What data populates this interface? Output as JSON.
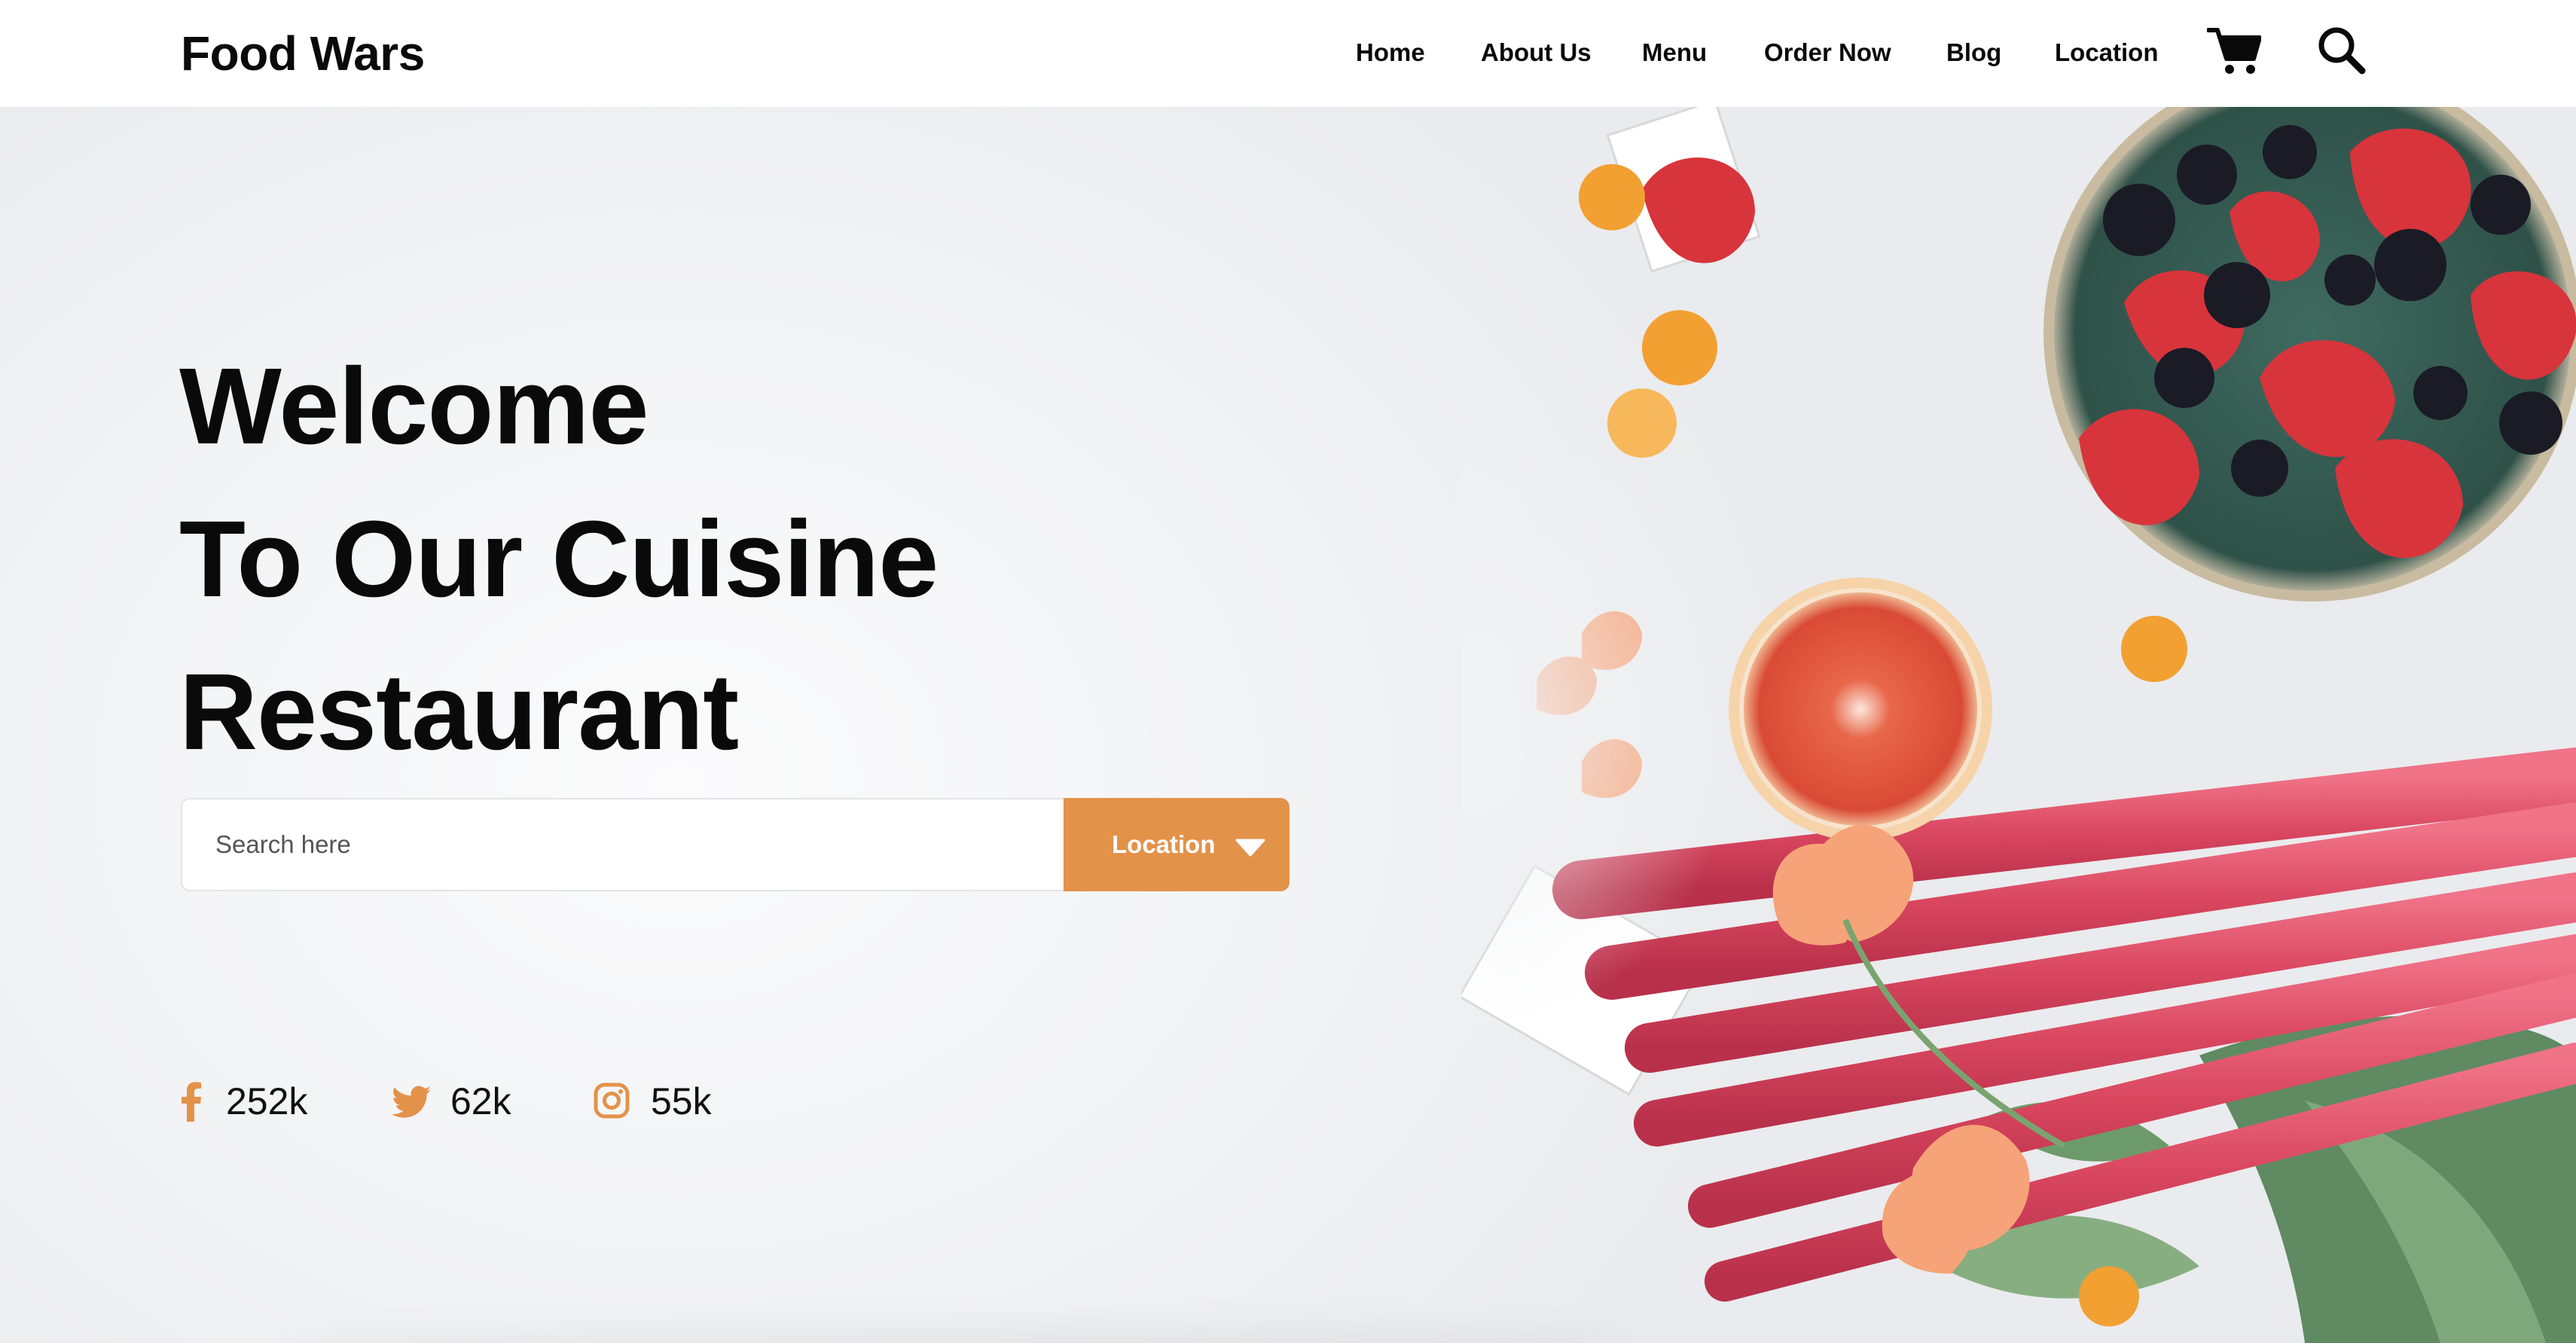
{
  "brand": {
    "name": "Food Wars"
  },
  "nav": {
    "items": [
      {
        "label": "Home"
      },
      {
        "label": "About Us"
      },
      {
        "label": "Menu"
      },
      {
        "label": "Order Now"
      },
      {
        "label": "Blog"
      },
      {
        "label": "Location"
      }
    ],
    "icons": [
      "cart-icon",
      "search-icon"
    ]
  },
  "hero": {
    "headline": [
      "Welcome",
      "To Our Cuisine",
      "Restaurant"
    ],
    "search": {
      "placeholder": "Search here",
      "value": ""
    },
    "location_button": {
      "label": "Location",
      "icon": "caret-down-icon"
    },
    "image": "fresh-fruit-and-rhubarb-photo"
  },
  "social": [
    {
      "icon": "facebook-icon",
      "count": "252k"
    },
    {
      "icon": "twitter-icon",
      "count": "62k"
    },
    {
      "icon": "instagram-icon",
      "count": "55k"
    }
  ],
  "colors": {
    "accent": "#e3924a",
    "text": "#0a0a0a",
    "background": "#f1f2f4"
  }
}
